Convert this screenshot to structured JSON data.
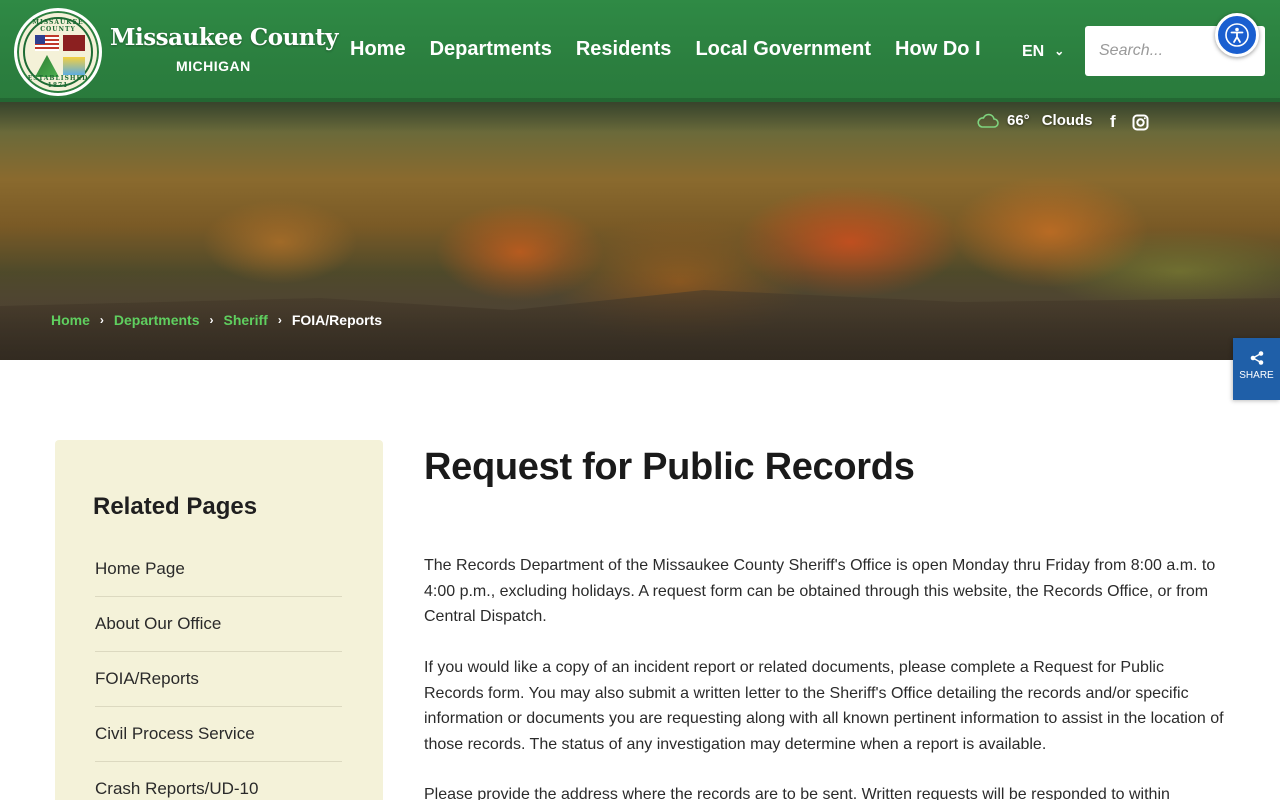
{
  "header": {
    "brand_name": "Missaukee County",
    "brand_sub": "MICHIGAN",
    "logo_top_text": "MISSAUKEE COUNTY",
    "logo_bottom_text": "ESTABLISHED 1871",
    "nav": [
      {
        "label": "Home"
      },
      {
        "label": "Departments"
      },
      {
        "label": "Residents"
      },
      {
        "label": "Local Government"
      },
      {
        "label": "How Do I"
      }
    ],
    "lang": "EN",
    "search_placeholder": "Search..."
  },
  "weather": {
    "temp": "66°",
    "condition": "Clouds",
    "icon": "cloud-icon"
  },
  "social": [
    {
      "icon": "facebook-icon",
      "glyph": "f"
    },
    {
      "icon": "instagram-icon"
    }
  ],
  "breadcrumb": [
    {
      "label": "Home"
    },
    {
      "label": "Departments"
    },
    {
      "label": "Sheriff"
    },
    {
      "label": "FOIA/Reports"
    }
  ],
  "share": {
    "label": "SHARE",
    "icon": "share-icon"
  },
  "sidebar": {
    "title": "Related Pages",
    "items": [
      {
        "label": "Home Page"
      },
      {
        "label": "About Our Office"
      },
      {
        "label": "FOIA/Reports"
      },
      {
        "label": "Civil Process Service"
      },
      {
        "label": "Crash Reports/UD-10"
      }
    ]
  },
  "main": {
    "title": "Request for Public Records",
    "paragraphs": [
      "The Records Department of the Missaukee County Sheriff's Office is open Monday thru Friday from 8:00 a.m. to 4:00 p.m., excluding holidays.  A request form can be obtained through this website, the Records Office, or from Central Dispatch.",
      "If you would like a copy of an incident report or related documents, please complete a Request for Public Records form.   You may also submit a written letter to the Sheriff's Office detailing the records and/or specific information or documents you are requesting along with all known pertinent information to assist in the location of those records.   The status of any investigation may determine when a report is available.",
      "Please provide the address where the records are to be sent.  Written requests will be responded to within"
    ]
  },
  "colors": {
    "header_green": "#2b7f3f",
    "breadcrumb_link": "#5fcf5f",
    "sidebar_bg": "#f4f2d9",
    "share_blue": "#1f5fa8",
    "a11y_blue": "#1a5fd0"
  },
  "accessibility": {
    "icon": "accessibility-icon"
  }
}
